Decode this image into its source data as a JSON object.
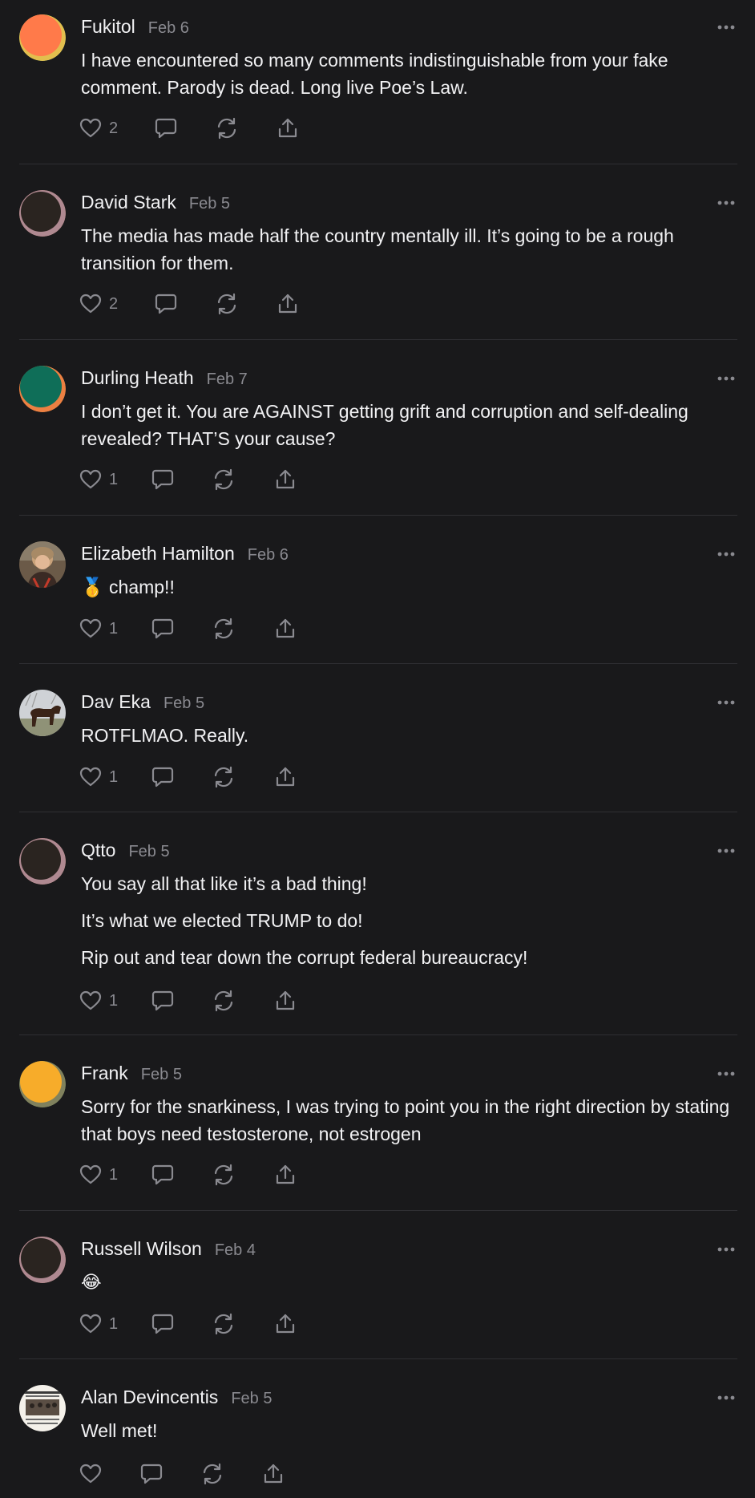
{
  "comments": [
    {
      "author": "Fukitol",
      "date": "Feb 6",
      "paragraphs": [
        "I have encountered so many comments indistinguishable from your fake comment. Parody is dead. Long live Poe’s Law."
      ],
      "likes": "2",
      "avatar": {
        "kind": "gradient",
        "base": "#ff7a4a",
        "accent": "#2a9d6e"
      }
    },
    {
      "author": "David Stark",
      "date": "Feb 5",
      "paragraphs": [
        "The media has made half the country mentally ill. It’s going to be a rough transition for them."
      ],
      "likes": "2",
      "avatar": {
        "kind": "gradient",
        "base": "#2a2420",
        "accent": "#f0873a"
      }
    },
    {
      "author": "Durling Heath",
      "date": "Feb 7",
      "paragraphs": [
        "I don’t get it. You are AGAINST getting grift and corruption and self-dealing revealed? THAT’S your cause?"
      ],
      "likes": "1",
      "avatar": {
        "kind": "gradient",
        "base": "#0f6e58",
        "accent": "#f0a03a"
      }
    },
    {
      "author": "Elizabeth Hamilton",
      "date": "Feb 6",
      "paragraphs": [
        "🥇 champ!!"
      ],
      "likes": "1",
      "avatar": {
        "kind": "photo-person"
      }
    },
    {
      "author": "Dav Eka",
      "date": "Feb 5",
      "paragraphs": [
        "ROTFLMAO. Really."
      ],
      "likes": "1",
      "avatar": {
        "kind": "photo-horse"
      }
    },
    {
      "author": "Qtto",
      "date": "Feb 5",
      "paragraphs": [
        "You say all that like it’s a bad thing!",
        "It’s what we elected TRUMP to do!",
        "Rip out and tear down the corrupt federal bureaucracy!"
      ],
      "likes": "1",
      "avatar": {
        "kind": "gradient",
        "base": "#2a2420",
        "accent": "#f0873a"
      }
    },
    {
      "author": "Frank",
      "date": "Feb 5",
      "paragraphs": [
        "Sorry for the snarkiness, I was trying to point you in the right direction by stating that boys need testosterone, not estrogen"
      ],
      "likes": "1",
      "avatar": {
        "kind": "gradient",
        "base": "#f7ac2a",
        "accent": "#2a9d6e"
      }
    },
    {
      "author": "Russell Wilson",
      "date": "Feb 4",
      "paragraphs": [
        "😂"
      ],
      "likes": "1",
      "avatar": {
        "kind": "gradient",
        "base": "#2a2420",
        "accent": "#f0873a"
      }
    },
    {
      "author": "Alan Devincentis",
      "date": "Feb 5",
      "paragraphs": [
        "Well met!"
      ],
      "likes": "",
      "avatar": {
        "kind": "photo-meme"
      }
    }
  ],
  "icons": {
    "like": "heart-icon",
    "reply": "comment-bubble-icon",
    "restack": "restack-icon",
    "share": "share-icon",
    "more": "more-dots-icon"
  },
  "colors": {
    "background": "#19191b",
    "text": "#f2f2f4",
    "muted": "#8a8a90",
    "divider": "#2f2f33"
  }
}
